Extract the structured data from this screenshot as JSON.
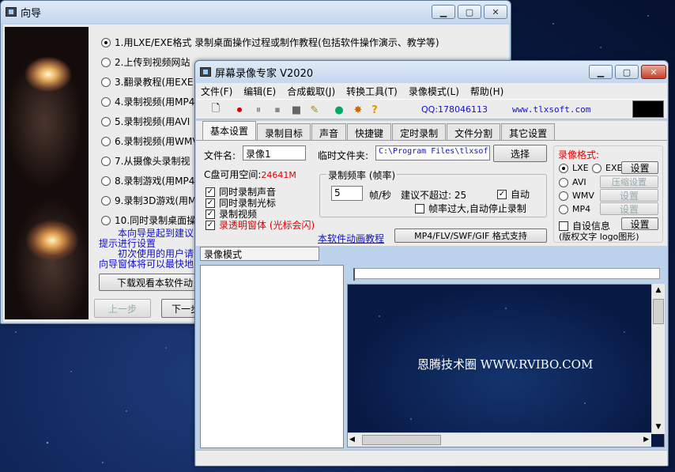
{
  "wizard": {
    "title": "向导",
    "options": [
      "1.用LXE/EXE格式 录制桌面操作过程或制作教程(包括软件操作演示、教学等)",
      "2.上传到视频网站",
      "3.翻录教程(用EXE",
      "4.录制视频(用MP4",
      "5.录制视频(用AVI",
      "6.录制视频(用WMV",
      "7.从摄像头录制视",
      "8.录制游戏(用MP4",
      "9.录制3D游戏(用M",
      "10.同时录制桌面操"
    ],
    "hint_lines": [
      "本向导是起到建议",
      "提示进行设置",
      "初次使用的用户请",
      "向导窗体将可以最快地"
    ],
    "download_btn": "下载观看本软件动",
    "prev_btn": "上一步",
    "next_btn": "下一步"
  },
  "main": {
    "title": "屏幕录像专家 V2020",
    "menu": [
      "文件(F)",
      "编辑(E)",
      "合成截取(J)",
      "转换工具(T)",
      "录像模式(L)",
      "帮助(H)"
    ],
    "qq": "QQ:178046113",
    "website": "www.tlxsoft.com",
    "tabs": [
      "基本设置",
      "录制目标",
      "声音",
      "快捷键",
      "定时录制",
      "文件分割",
      "其它设置"
    ],
    "filename_label": "文件名:",
    "filename_value": "录像1",
    "tempdir_label": "临时文件夹:",
    "tempdir_value": "C:\\Program Files\\tlxsof",
    "select_btn": "选择",
    "disk_label": "C盘可用空间:",
    "disk_value": "24641M",
    "checks": [
      {
        "label": "同时录制声音",
        "checked": true,
        "red": false
      },
      {
        "label": "同时录制光标",
        "checked": true,
        "red": false
      },
      {
        "label": "录制视频",
        "checked": true,
        "red": false
      },
      {
        "label": "录透明窗体 (光标会闪)",
        "checked": true,
        "red": true
      }
    ],
    "freq_group": "录制频率 (帧率)",
    "fps_value": "5",
    "fps_unit": "帧/秒",
    "suggest": "建议不超过: 25",
    "auto_label": "自动",
    "auto_checked": true,
    "autostop_label": "帧率过大,自动停止录制",
    "tutorial_link": "本软件动画教程",
    "formats_btn": "MP4/FLV/SWF/GIF  格式支持",
    "format_group": "录像格式:",
    "formats": [
      {
        "label": "LXE",
        "selected": true
      },
      {
        "label": "EXE",
        "selected": false
      },
      {
        "label": "AVI",
        "selected": false
      },
      {
        "label": "WMV",
        "selected": false
      },
      {
        "label": "MP4",
        "selected": false
      }
    ],
    "settings_btn": "设置",
    "compress_btn": "压缩设置",
    "custom_label": "自设信息",
    "custom_note": "(版权文字 logo图形)",
    "mode_label": "录像模式",
    "watermark": "恩腾技术圈 WWW.RVIBO.COM"
  }
}
